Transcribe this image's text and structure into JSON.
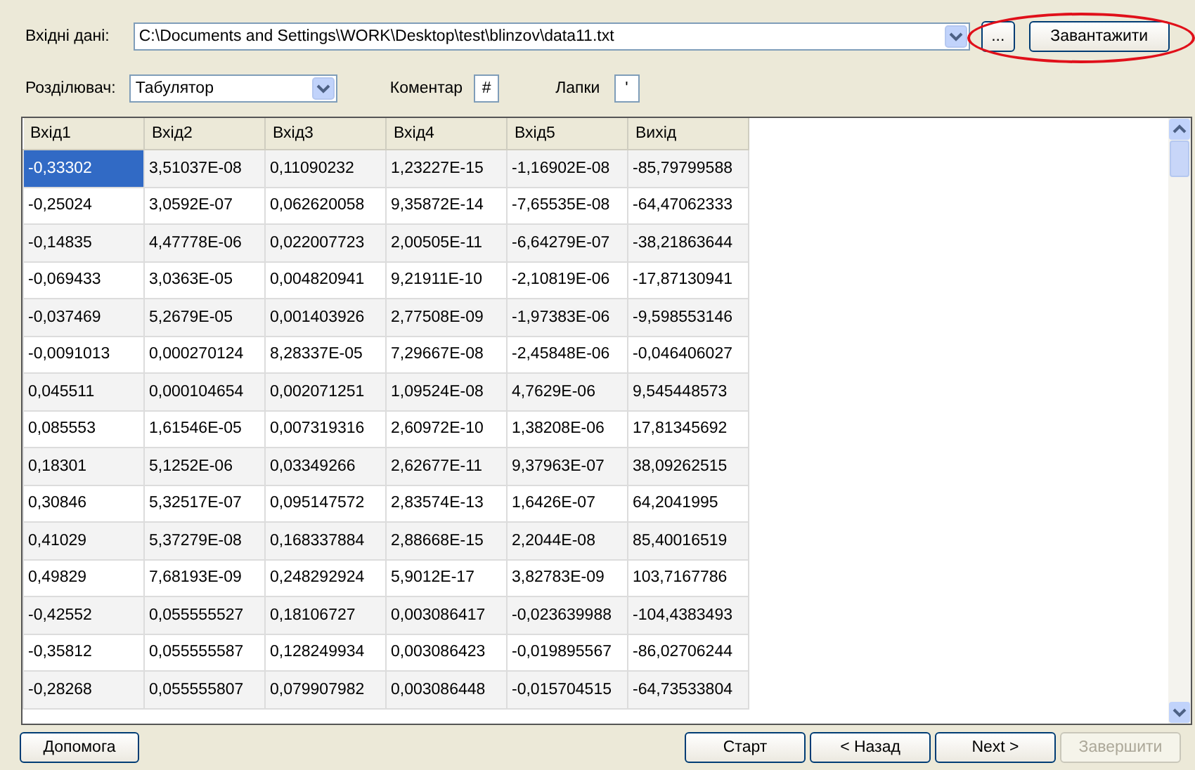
{
  "input_row": {
    "label": "Вхідні дані:",
    "path": "C:\\Documents and Settings\\WORK\\Desktop\\test\\blinzov\\data11.txt",
    "browse_button": "...",
    "load_button": "Завантажити"
  },
  "options_row": {
    "separator_label": "Розділювач:",
    "separator_value": "Табулятор",
    "comment_label": "Коментар",
    "comment_value": "#",
    "quotes_label": "Лапки",
    "quotes_value": "'"
  },
  "table": {
    "columns": [
      "Вхід1",
      "Вхід2",
      "Вхід3",
      "Вхід4",
      "Вхід5",
      "Вихід"
    ],
    "rows": [
      {
        "selected": true,
        "cells": [
          "-0,33302",
          "3,51037E-08",
          "0,11090232",
          "1,23227E-15",
          "-1,16902E-08",
          "-85,79799588"
        ]
      },
      {
        "selected": false,
        "cells": [
          "-0,25024",
          "3,0592E-07",
          "0,062620058",
          "9,35872E-14",
          "-7,65535E-08",
          "-64,47062333"
        ]
      },
      {
        "selected": false,
        "cells": [
          "-0,14835",
          "4,47778E-06",
          "0,022007723",
          "2,00505E-11",
          "-6,64279E-07",
          "-38,21863644"
        ]
      },
      {
        "selected": false,
        "cells": [
          "-0,069433",
          "3,0363E-05",
          "0,004820941",
          "9,21911E-10",
          "-2,10819E-06",
          "-17,87130941"
        ]
      },
      {
        "selected": false,
        "cells": [
          "-0,037469",
          "5,2679E-05",
          "0,001403926",
          "2,77508E-09",
          "-1,97383E-06",
          "-9,598553146"
        ]
      },
      {
        "selected": false,
        "cells": [
          "-0,0091013",
          "0,000270124",
          "8,28337E-05",
          "7,29667E-08",
          "-2,45848E-06",
          "-0,046406027"
        ]
      },
      {
        "selected": false,
        "cells": [
          "0,045511",
          "0,000104654",
          "0,002071251",
          "1,09524E-08",
          "4,7629E-06",
          "9,545448573"
        ]
      },
      {
        "selected": false,
        "cells": [
          "0,085553",
          "1,61546E-05",
          "0,007319316",
          "2,60972E-10",
          "1,38208E-06",
          "17,81345692"
        ]
      },
      {
        "selected": false,
        "cells": [
          "0,18301",
          "5,1252E-06",
          "0,03349266",
          "2,62677E-11",
          "9,37963E-07",
          "38,09262515"
        ]
      },
      {
        "selected": false,
        "cells": [
          "0,30846",
          "5,32517E-07",
          "0,095147572",
          "2,83574E-13",
          "1,6426E-07",
          "64,2041995"
        ]
      },
      {
        "selected": false,
        "cells": [
          "0,41029",
          "5,37279E-08",
          "0,168337884",
          "2,88668E-15",
          "2,2044E-08",
          "85,40016519"
        ]
      },
      {
        "selected": false,
        "cells": [
          "0,49829",
          "7,68193E-09",
          "0,248292924",
          "5,9012E-17",
          "3,82783E-09",
          "103,7167786"
        ]
      },
      {
        "selected": false,
        "cells": [
          "-0,42552",
          "0,055555527",
          "0,18106727",
          "0,003086417",
          "-0,023639988",
          "-104,4383493"
        ]
      },
      {
        "selected": false,
        "cells": [
          "-0,35812",
          "0,055555587",
          "0,128249934",
          "0,003086423",
          "-0,019895567",
          "-86,02706244"
        ]
      },
      {
        "selected": false,
        "cells": [
          "-0,28268",
          "0,055555807",
          "0,079907982",
          "0,003086448",
          "-0,015704515",
          "-64,73533804"
        ]
      }
    ]
  },
  "footer": {
    "help_button": "Допомога",
    "buttons": [
      {
        "label": "Старт",
        "disabled": false
      },
      {
        "label": "< Назад",
        "disabled": false
      },
      {
        "label": "Next >",
        "disabled": false
      },
      {
        "label": "Завершити",
        "disabled": true
      }
    ]
  }
}
